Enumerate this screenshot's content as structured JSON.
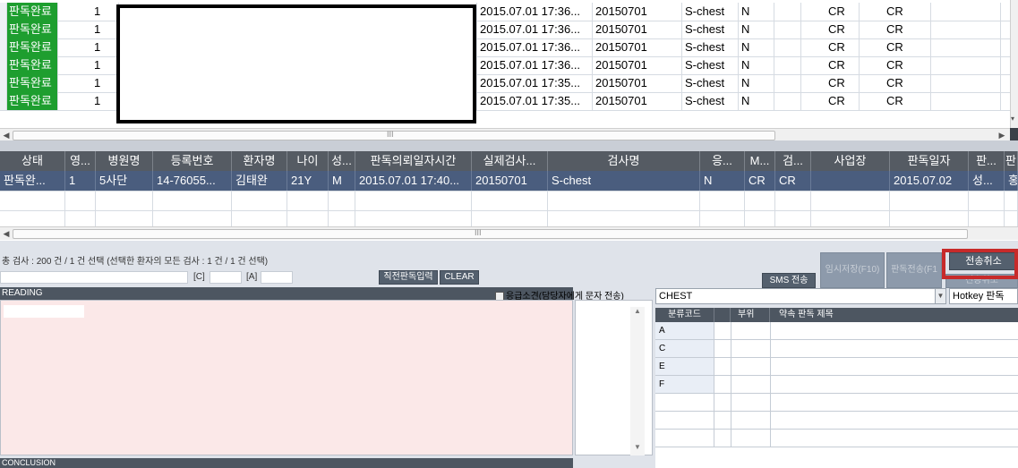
{
  "top_grid": {
    "rows": [
      {
        "status": "판독완료",
        "count": "1",
        "datetime": "2015.07.01 17:36...",
        "date": "20150701",
        "exam": "S-chest",
        "emerg": "N",
        "mod1": "CR",
        "mod2": "CR"
      },
      {
        "status": "판독완료",
        "count": "1",
        "datetime": "2015.07.01 17:36...",
        "date": "20150701",
        "exam": "S-chest",
        "emerg": "N",
        "mod1": "CR",
        "mod2": "CR"
      },
      {
        "status": "판독완료",
        "count": "1",
        "datetime": "2015.07.01 17:36...",
        "date": "20150701",
        "exam": "S-chest",
        "emerg": "N",
        "mod1": "CR",
        "mod2": "CR"
      },
      {
        "status": "판독완료",
        "count": "1",
        "datetime": "2015.07.01 17:36...",
        "date": "20150701",
        "exam": "S-chest",
        "emerg": "N",
        "mod1": "CR",
        "mod2": "CR"
      },
      {
        "status": "판독완료",
        "count": "1",
        "datetime": "2015.07.01 17:35...",
        "date": "20150701",
        "exam": "S-chest",
        "emerg": "N",
        "mod1": "CR",
        "mod2": "CR"
      },
      {
        "status": "판독완료",
        "count": "1",
        "datetime": "2015.07.01 17:35...",
        "date": "20150701",
        "exam": "S-chest",
        "emerg": "N",
        "mod1": "CR",
        "mod2": "CR"
      }
    ]
  },
  "bottom_grid": {
    "headers": [
      "상태",
      "영...",
      "병원명",
      "등록번호",
      "환자명",
      "나이",
      "성...",
      "판독의뢰일자시간",
      "실제검사...",
      "검사명",
      "응...",
      "M...",
      "검...",
      "사업장",
      "판독일자",
      "판...",
      "판"
    ],
    "row": [
      "판독완...",
      "1",
      "5사단",
      "14-76055...",
      "김태완",
      "21Y",
      "M",
      "2015.07.01 17:40...",
      "20150701",
      "S-chest",
      "N",
      "CR",
      "CR",
      "",
      "2015.07.02",
      "성...",
      "홍"
    ]
  },
  "summary": {
    "text": "총 검사 : 200 건 / 1 건 선택 (선택한 환자의 모든 검사 : 1 건 / 1 건 선택)",
    "c_label": "[C]",
    "a_label": "[A]"
  },
  "buttons": {
    "direct_input": "직전판독입력",
    "clear": "CLEAR",
    "sms": "SMS 전송",
    "temp_save": "임시저장(F10)",
    "send": "판독전송(F1",
    "cancel_send": "전송취소",
    "cancel_faded": "전송취소"
  },
  "reading": {
    "header": "READING",
    "emergency_checkbox": "응급소견(담당자에게 문자 전송)",
    "conclusion": "CONCLUSION"
  },
  "right_panel": {
    "category": "CHEST",
    "hotkey": "Hotkey 판독",
    "headers": [
      "분류코드",
      "부위",
      "약속 판독 제목"
    ],
    "codes": [
      "A",
      "C",
      "E",
      "F",
      "",
      "",
      ""
    ]
  }
}
